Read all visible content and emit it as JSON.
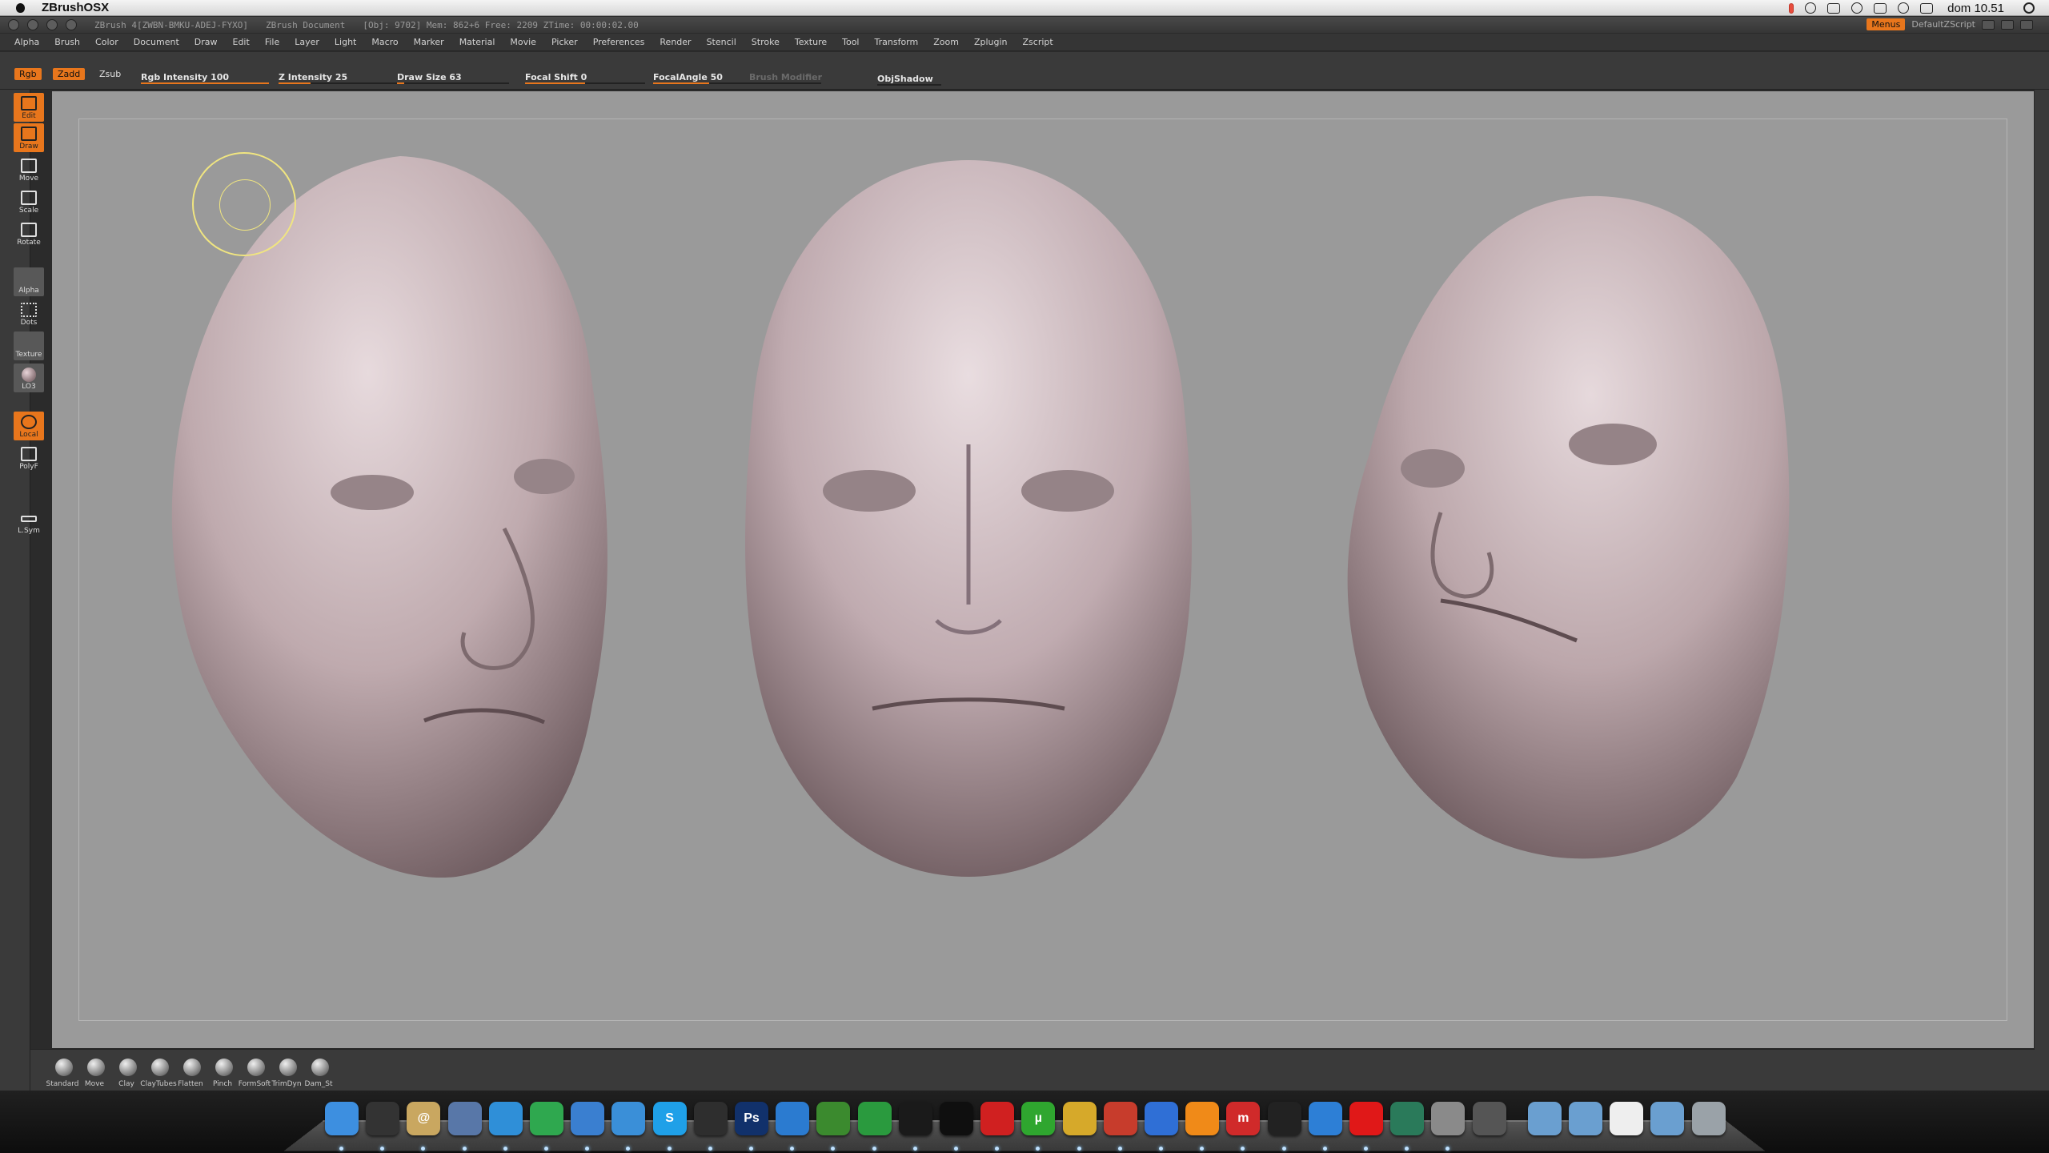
{
  "mac_menubar": {
    "app_name": "ZBrushOSX",
    "clock": "dom 10.51"
  },
  "zb_title": {
    "version": "ZBrush 4[ZWBN-BMKU-ADEJ-FYXO]",
    "document": "ZBrush Document",
    "stats": "[Obj: 9702]  Mem: 862+6  Free: 2209  ZTime: 00:00:02.00",
    "menus_button": "Menus",
    "zscript": "DefaultZScript"
  },
  "menu": [
    "Alpha",
    "Brush",
    "Color",
    "Document",
    "Draw",
    "Edit",
    "File",
    "Layer",
    "Light",
    "Macro",
    "Marker",
    "Material",
    "Movie",
    "Picker",
    "Preferences",
    "Render",
    "Stencil",
    "Stroke",
    "Texture",
    "Tool",
    "Transform",
    "Zoom",
    "Zplugin",
    "Zscript"
  ],
  "top_shelf": {
    "rgb": "Rgb",
    "zadd": "Zadd",
    "zsub": "Zsub",
    "rgb_intensity": {
      "label": "Rgb Intensity 100",
      "value": 100,
      "max": 100
    },
    "z_intensity": {
      "label": "Z Intensity 25",
      "value": 25,
      "max": 100
    },
    "draw_size": {
      "label": "Draw Size 63",
      "value": 63,
      "max": 1000
    },
    "focal_shift": {
      "label": "Focal Shift 0",
      "value": 0,
      "min": -100,
      "max": 100
    },
    "focal_angle": {
      "label": "FocalAngle 50",
      "value": 50,
      "max": 100
    },
    "brush_modifier": {
      "label": "Brush Modifier",
      "value": 0
    },
    "objshadow": {
      "label": "ObjShadow",
      "value": 0
    }
  },
  "left_tools": {
    "edit": "Edit",
    "draw": "Draw",
    "move": "Move",
    "scale": "Scale",
    "rotate": "Rotate",
    "alpha": "Alpha",
    "dots": "Dots",
    "texture": "Texture",
    "lo3": "LO3",
    "local": "Local",
    "polyf": "PolyF",
    "lsym": "L.Sym"
  },
  "brushes": [
    "Standard",
    "Move",
    "Clay",
    "ClayTubes",
    "Flatten",
    "Pinch",
    "FormSoft",
    "TrimDyn",
    "Dam_St"
  ],
  "dock_apps": [
    {
      "name": "finder-icon",
      "color": "#3d8fe0",
      "glyph": ""
    },
    {
      "name": "dashboard-icon",
      "color": "#333",
      "glyph": ""
    },
    {
      "name": "mail-icon",
      "color": "#c9a760",
      "glyph": "@"
    },
    {
      "name": "preview-icon",
      "color": "#5877a8",
      "glyph": ""
    },
    {
      "name": "safari-icon",
      "color": "#2f8fd8",
      "glyph": ""
    },
    {
      "name": "chrome-icon",
      "color": "#2fa84f",
      "glyph": ""
    },
    {
      "name": "facetime-icon",
      "color": "#3a7fd0",
      "glyph": ""
    },
    {
      "name": "messenger-icon",
      "color": "#3a8fd8",
      "glyph": ""
    },
    {
      "name": "skype-icon",
      "color": "#1fa0e8",
      "glyph": "S"
    },
    {
      "name": "contacts-icon",
      "color": "#2e2e2e",
      "glyph": ""
    },
    {
      "name": "photoshop-icon",
      "color": "#11316b",
      "glyph": "Ps"
    },
    {
      "name": "numbers-icon",
      "color": "#2b7bd0",
      "glyph": ""
    },
    {
      "name": "plant-icon",
      "color": "#3b8a2e",
      "glyph": ""
    },
    {
      "name": "keynote-icon",
      "color": "#2a9a3e",
      "glyph": ""
    },
    {
      "name": "dolphin-icon",
      "color": "#1a1a1a",
      "glyph": ""
    },
    {
      "name": "runner-icon",
      "color": "#0f0f0f",
      "glyph": ""
    },
    {
      "name": "spb-icon",
      "color": "#d02020",
      "glyph": ""
    },
    {
      "name": "utorrent-icon",
      "color": "#2fa62f",
      "glyph": "µ"
    },
    {
      "name": "jdownloader-icon",
      "color": "#d6a92a",
      "glyph": ""
    },
    {
      "name": "monitor-icon",
      "color": "#c73c2c",
      "glyph": ""
    },
    {
      "name": "itunes-icon",
      "color": "#2f6fd6",
      "glyph": ""
    },
    {
      "name": "vlc-icon",
      "color": "#f08a18",
      "glyph": ""
    },
    {
      "name": "miro-icon",
      "color": "#d02a2a",
      "glyph": "m"
    },
    {
      "name": "plex-icon",
      "color": "#222",
      "glyph": ""
    },
    {
      "name": "appstore-icon",
      "color": "#2d7fd6",
      "glyph": ""
    },
    {
      "name": "vodafone-icon",
      "color": "#e01818",
      "glyph": ""
    },
    {
      "name": "timemachine-icon",
      "color": "#2a7a5a",
      "glyph": ""
    },
    {
      "name": "sysprefs-icon",
      "color": "#8a8a8a",
      "glyph": ""
    },
    {
      "name": "mic-icon",
      "color": "#555",
      "glyph": ""
    },
    {
      "name": "applications-folder-icon",
      "color": "#6a9fd0",
      "glyph": ""
    },
    {
      "name": "documents-folder-icon",
      "color": "#6a9fd0",
      "glyph": ""
    },
    {
      "name": "document-icon",
      "color": "#eeeeee",
      "glyph": ""
    },
    {
      "name": "downloads-folder-icon",
      "color": "#6a9fd0",
      "glyph": ""
    },
    {
      "name": "trash-icon",
      "color": "#9aa2a8",
      "glyph": ""
    }
  ],
  "colors": {
    "accent": "#e8761c",
    "canvas": "#9a9a9a",
    "ui": "#3a3a3a",
    "skin_light": "#d9c9cc",
    "skin_dark": "#6c5a5e"
  }
}
